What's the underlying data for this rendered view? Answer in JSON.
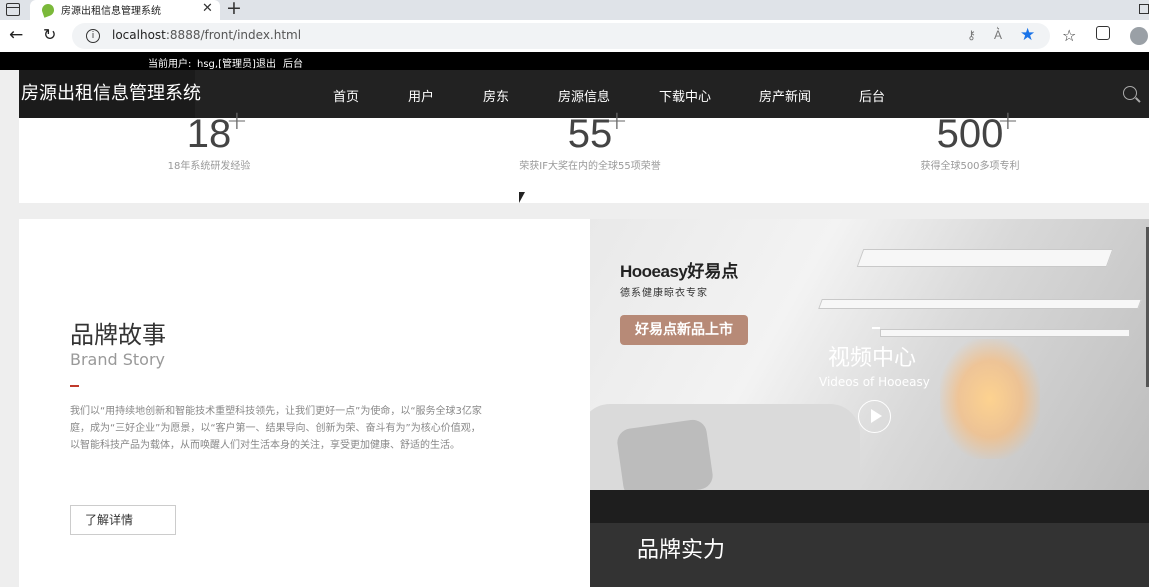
{
  "browser": {
    "tab_title": "房源出租信息管理系统",
    "tab_close": "✕",
    "new_tab": "+",
    "url_host": "localhost",
    "url_path": ":8888/front/index.html",
    "back_glyph": "←",
    "reload_glyph": "↻",
    "info_glyph": "i",
    "favorite_glyph": "★",
    "favorites_glyph": "☆"
  },
  "userbar": {
    "current_user_label": "当前用户:",
    "user_name": "hsg,[管理员]",
    "logout": "退出",
    "backend": "后台"
  },
  "nav": {
    "brand": "房源出租信息管理系统",
    "items": [
      "首页",
      "用户",
      "房东",
      "房源信息",
      "下载中心",
      "房产新闻",
      "后台"
    ]
  },
  "stats": [
    {
      "number": "18",
      "plus": "+",
      "label": "18年系统研发经验"
    },
    {
      "number": "55",
      "plus": "+",
      "label": "荣获IF大奖在内的全球55项荣誉"
    },
    {
      "number": "500",
      "plus": "+",
      "label": "获得全球500多项专利"
    }
  ],
  "story": {
    "title": "品牌故事",
    "subtitle": "Brand Story",
    "text": "我们以“用持续地创新和智能技术重塑科技领先，让我们更好一点”为使命，以“服务全球3亿家庭，成为“三好企业”为愿景，以“客户第一、结果导向、创新为荣、奋斗有为”为核心价值观，以智能科技产品为载体，从而唤醒人们对生活本身的关注，享受更加健康、舒适的生活。",
    "button": "了解详情"
  },
  "video": {
    "logo_en": "Hooeasy",
    "logo_cn": "好易点",
    "logo_tag": "德系健康晾衣专家",
    "promo": "好易点新品上市",
    "dash": "–",
    "title": "视频中心",
    "subtitle": "Videos of Hooeasy"
  },
  "strength": {
    "title": "品牌实力"
  }
}
